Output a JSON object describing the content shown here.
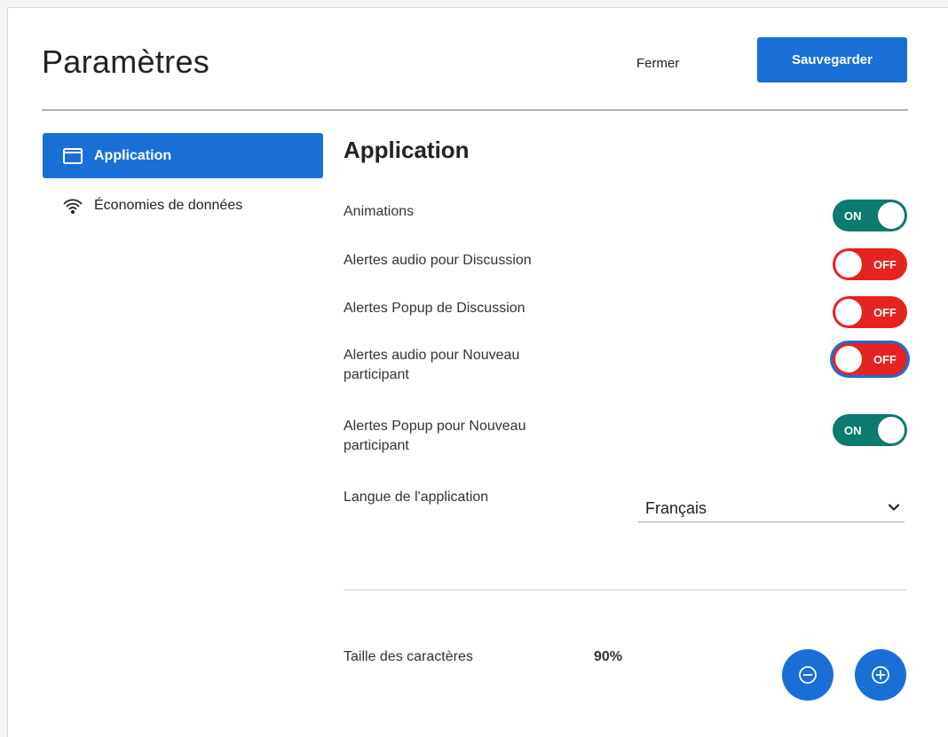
{
  "header": {
    "title": "Paramètres",
    "close_label": "Fermer",
    "save_label": "Sauvegarder"
  },
  "sidebar": {
    "items": [
      {
        "label": "Application",
        "icon": "window-icon",
        "active": true
      },
      {
        "label": "Économies de données",
        "icon": "wifi-icon",
        "active": false
      }
    ]
  },
  "main": {
    "section_title": "Application",
    "settings": [
      {
        "label": "Animations",
        "state": "ON"
      },
      {
        "label": "Alertes audio pour Discussion",
        "state": "OFF"
      },
      {
        "label": "Alertes Popup de Discussion",
        "state": "OFF"
      },
      {
        "label": "Alertes audio pour Nouveau participant",
        "state": "OFF"
      },
      {
        "label": "Alertes Popup pour Nouveau participant",
        "state": "ON"
      }
    ],
    "language": {
      "label": "Langue de l'application",
      "selected": "Français"
    },
    "font_size": {
      "label": "Taille des caractères",
      "value": "90%"
    }
  },
  "colors": {
    "primary": "#1a6fd6",
    "toggle_on": "#0b7a6f",
    "toggle_off": "#e52320"
  }
}
